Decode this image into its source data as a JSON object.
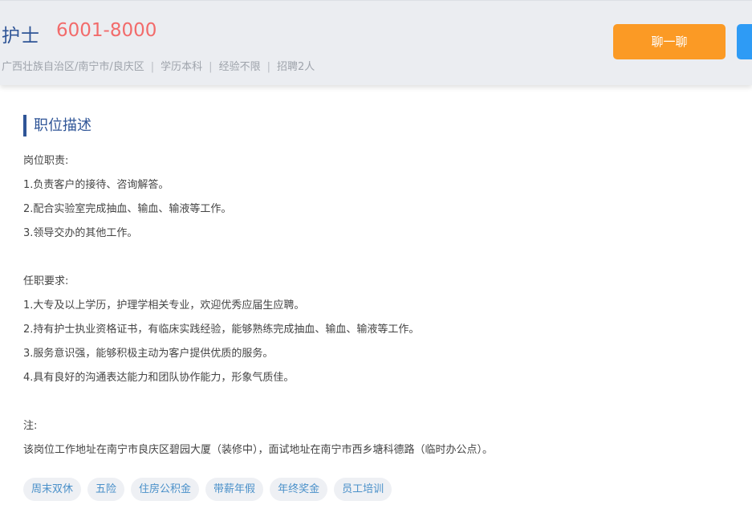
{
  "header": {
    "job_title": "护士",
    "salary": "6001-8000",
    "location": "广西壮族自治区/南宁市/良庆区",
    "education": "学历本科",
    "experience": "经验不限",
    "headcount": "招聘2人",
    "separator": "|",
    "chat_button": "聊一聊"
  },
  "section": {
    "title": "职位描述"
  },
  "description": {
    "duties_heading": "岗位职责:",
    "duties": [
      "1.负责客户的接待、咨询解答。",
      "2.配合实验室完成抽血、输血、输液等工作。",
      "3.领导交办的其他工作。"
    ],
    "requirements_heading": "任职要求:",
    "requirements": [
      "1.大专及以上学历，护理学相关专业，欢迎优秀应届生应聘。",
      "2.持有护士执业资格证书，有临床实践经验，能够熟练完成抽血、输血、输液等工作。",
      "3.服务意识强，能够积极主动为客户提供优质的服务。",
      "4.具有良好的沟通表达能力和团队协作能力，形象气质佳。"
    ],
    "note_heading": "注:",
    "note": "该岗位工作地址在南宁市良庆区碧园大厦（装修中），面试地址在南宁市西乡塘科德路（临时办公点）。"
  },
  "tags": [
    "周末双休",
    "五险",
    "住房公积金",
    "带薪年假",
    "年终奖金",
    "员工培训"
  ],
  "colors": {
    "accent_blue": "#2f5597",
    "salary_red": "#f26b6b",
    "chat_orange": "#fb9a25",
    "secondary_button_blue": "#2e9bf5",
    "tag_text": "#4a90c9"
  }
}
